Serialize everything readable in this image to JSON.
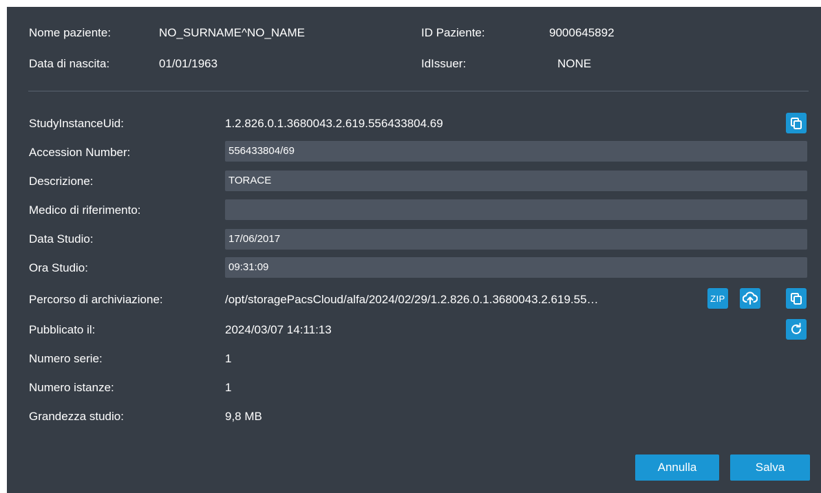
{
  "patient": {
    "name_label": "Nome paziente:",
    "name_value": "NO_SURNAME^NO_NAME",
    "dob_label": "Data di nascita:",
    "dob_value": "01/01/1963",
    "id_label": "ID Paziente:",
    "id_value": "9000645892",
    "issuer_label": "IdIssuer:",
    "issuer_value": "NONE"
  },
  "study": {
    "uid_label": "StudyInstanceUid:",
    "uid_value": "1.2.826.0.1.3680043.2.619.556433804.69",
    "accession_label": "Accession Number:",
    "accession_value": "556433804/69",
    "description_label": "Descrizione:",
    "description_value": "TORACE",
    "referring_label": "Medico di riferimento:",
    "referring_value": "",
    "date_label": "Data Studio:",
    "date_value": "17/06/2017",
    "time_label": "Ora Studio:",
    "time_value": "09:31:09",
    "path_label": "Percorso di archiviazione:",
    "path_value": "/opt/storagePacsCloud/alfa/2024/02/29/1.2.826.0.1.3680043.2.619.55…",
    "published_label": "Pubblicato il:",
    "published_value": "2024/03/07 14:11:13",
    "series_label": "Numero serie:",
    "series_value": "1",
    "instances_label": "Numero istanze:",
    "instances_value": "1",
    "size_label": "Grandezza studio:",
    "size_value": "9,8 MB"
  },
  "icons": {
    "copy": "copy-icon",
    "zip": "zip-icon",
    "upload": "cloud-upload-icon",
    "refresh": "refresh-icon",
    "zip_text": "ZIP"
  },
  "footer": {
    "cancel_label": "Annulla",
    "save_label": "Salva"
  },
  "colors": {
    "background": "#363d46",
    "field": "#4d5561",
    "accent": "#1a96d4"
  }
}
